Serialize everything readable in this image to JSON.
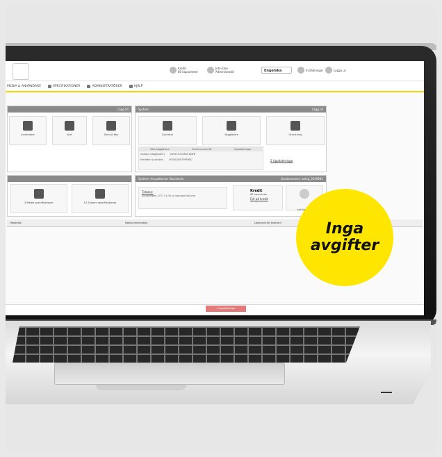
{
  "badge": {
    "line1": "Inga",
    "line2": "avgifter"
  },
  "topbar": {
    "credit_label": "Kredit",
    "credit_sub": "80 kapaciteter",
    "user_name": "John Doe",
    "user_sub": "Administratör",
    "selected_value": "Engelska",
    "settings_label": "Inställningar",
    "logout_label": "Logga ut"
  },
  "menu": {
    "items": [
      "MEDIA & ANVÄNDARE",
      "SPECIFIKATIONER",
      "ADMINISTRATÖRER",
      "HJÄLP"
    ]
  },
  "left_panel": {
    "add_label": "Lägg till",
    "tiles": [
      "Användare",
      "Kort",
      "Send-A-Key"
    ]
  },
  "system_panel": {
    "title": "System",
    "add_label": "Lägg till",
    "tiles": [
      "Cylindrar",
      "Väggläsare",
      "Utrustning"
    ],
    "table_headers": [
      "Dörr/väggläsare",
      "Serienummer/ID",
      "Uppdateringar"
    ],
    "rows": [
      {
        "name": "Garage (väggläsare)",
        "id": "0005C0710680 8DEB"
      },
      {
        "name": "Entrédörr (cylinder)",
        "id": "0005C0D57F998DC"
      }
    ],
    "updates_link": "2 Uppdateringar"
  },
  "spec_panel": {
    "tiles": [
      "3 Media specifikationer",
      "10 System specifikationer"
    ]
  },
  "info_panel": {
    "title": "System: Huvudkontor Stockholm",
    "right_info": "Kundnummer: anleg_0549281",
    "timezone_label": "Tidszon:",
    "timezone_value": "Europe/Wien, UTC +2.00, ej standard Volume",
    "credit_title": "Kredit",
    "credit_sub": "80 kapaciteter",
    "credit_link": "Fyll på kredit",
    "settings_label": "Inställningar"
  },
  "list": {
    "headers": [
      "Händelse",
      "Närlig information",
      "Lösenord för ändrand"
    ]
  },
  "bottom": {
    "button_label": "1 Uppdateringar"
  }
}
